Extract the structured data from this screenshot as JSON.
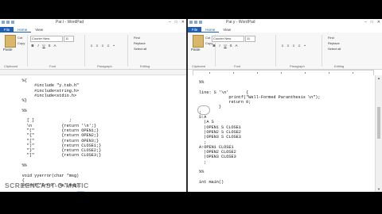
{
  "left_window": {
    "title": "Par.l - WordPad",
    "tabs": [
      "File",
      "Home",
      "View"
    ],
    "active_tab": "Home",
    "ribbon": {
      "paste": "Paste",
      "cut": "Cut",
      "copy": "Copy",
      "font_name": "Courier New",
      "font_size": "11",
      "groups": [
        "Clipboard",
        "Font",
        "Paragraph",
        "Editing"
      ],
      "find": "Find",
      "replace": "Replace",
      "select_all": "Select all"
    },
    "code": "     %{\n          #include \"y.tab.h\"\n          #include<string.h>\n          #include<stdio.h>\n     %}\n\n     %%\n\n       [ ]              ;\n       \\n            {return '\\n';}\n       \"(\"           {return OPEN1;}\n       \"{\"           {return OPEN2;}\n       \"[\"           {return OPEN3;}\n       \")\"           {return CLOSE1;}\n       \"}\"           {return CLOSE2;}\n       \"]\"           {return CLOSE3;}\n\n     %%\n\n     void yyerror(char *msg)\n     {\n     printf(\"Error: %s\",msg);",
    "selection_text": "msg"
  },
  "right_window": {
    "title": "Par.y - WordPad",
    "tabs": [
      "File",
      "Home",
      "View"
    ],
    "active_tab": "Home",
    "ribbon": {
      "paste": "Paste",
      "cut": "Cut",
      "copy": "Copy",
      "font_name": "Courier New",
      "font_size": "11",
      "groups": [
        "Clipboard",
        "Font",
        "Paragraph",
        "Editing"
      ],
      "find": "Find",
      "replace": "Replace",
      "select_all": "Select all"
    },
    "code": "%%\n\nline: S '\\n'       {\n            printf(\"Well-Formed Paranthesis \\n\");\n            return 0;\n        }\n;\nS:A\n  |A S\n  |OPEN1 S CLOSE1\n  |OPEN2 S CLOSE2\n  |OPEN3 S CLOSE3\n  ;\nA:OPEN1 CLOSE1\n  |OPEN2 CLOSE2\n  |OPEN3 CLOSE3\n  ;\n\n%%\n\nint main()"
  },
  "watermark": "SCREENCAST-O-MATIC"
}
